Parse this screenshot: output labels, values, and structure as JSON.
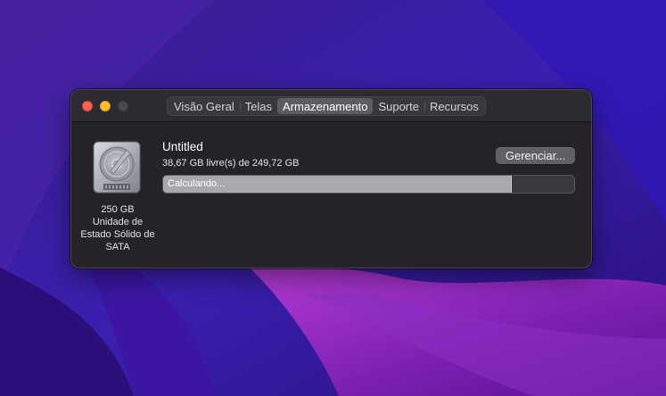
{
  "window": {
    "tabs": [
      {
        "label": "Visão Geral",
        "active": false
      },
      {
        "label": "Telas",
        "active": false
      },
      {
        "label": "Armazenamento",
        "active": true
      },
      {
        "label": "Suporte",
        "active": false
      },
      {
        "label": "Recursos",
        "active": false
      }
    ]
  },
  "drive": {
    "icon": "hard-drive-icon",
    "caption_lines": [
      "250 GB",
      "Unidade de",
      "Estado Sólido de",
      "SATA"
    ]
  },
  "volume": {
    "name": "Untitled",
    "free_text": "38,67 GB livre(s) de 249,72 GB",
    "manage_label": "Gerenciar...",
    "bar_label": "Calculando...",
    "used_fraction": 0.845
  },
  "colors": {
    "close": "#fe5f57",
    "minimize": "#febc2e",
    "zoom_inactive": "#4c4a50",
    "bar_fill": "#a9a8ad"
  }
}
